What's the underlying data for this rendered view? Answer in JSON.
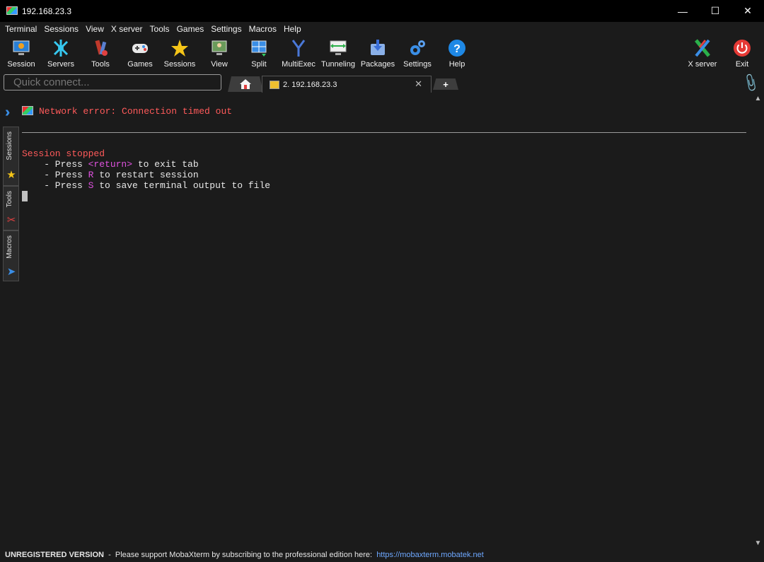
{
  "window": {
    "title": "192.168.23.3",
    "minimize": "—",
    "maximize": "☐",
    "close": "✕"
  },
  "menu": [
    "Terminal",
    "Sessions",
    "View",
    "X server",
    "Tools",
    "Games",
    "Settings",
    "Macros",
    "Help"
  ],
  "toolbar": {
    "session": "Session",
    "servers": "Servers",
    "tools": "Tools",
    "games": "Games",
    "sessions": "Sessions",
    "view": "View",
    "split": "Split",
    "multiexec": "MultiExec",
    "tunneling": "Tunneling",
    "packages": "Packages",
    "settings": "Settings",
    "help": "Help",
    "xserver": "X server",
    "exit": "Exit"
  },
  "quick_connect": {
    "placeholder": "Quick connect..."
  },
  "tabs": {
    "active_label": "2. 192.168.23.3",
    "close": "✕",
    "new": "+"
  },
  "sidebar": {
    "sessions": "Sessions",
    "tools": "Tools",
    "macros": "Macros"
  },
  "terminal": {
    "error": "Network error: Connection timed out",
    "stopped": "Session stopped",
    "line1_pre": "    - Press ",
    "line1_key": "<return>",
    "line1_post": " to exit tab",
    "line2_pre": "    - Press ",
    "line2_key": "R",
    "line2_post": " to restart session",
    "line3_pre": "    - Press ",
    "line3_key": "S",
    "line3_post": " to save terminal output to file"
  },
  "status": {
    "unregistered": "UNREGISTERED VERSION",
    "message": "  -  Please support MobaXterm by subscribing to the professional edition here:  ",
    "link": "https://mobaxterm.mobatek.net"
  },
  "colors": {
    "error_red": "#ff5a5a",
    "key_magenta": "#e052e0",
    "link_blue": "#6ea8ff"
  }
}
